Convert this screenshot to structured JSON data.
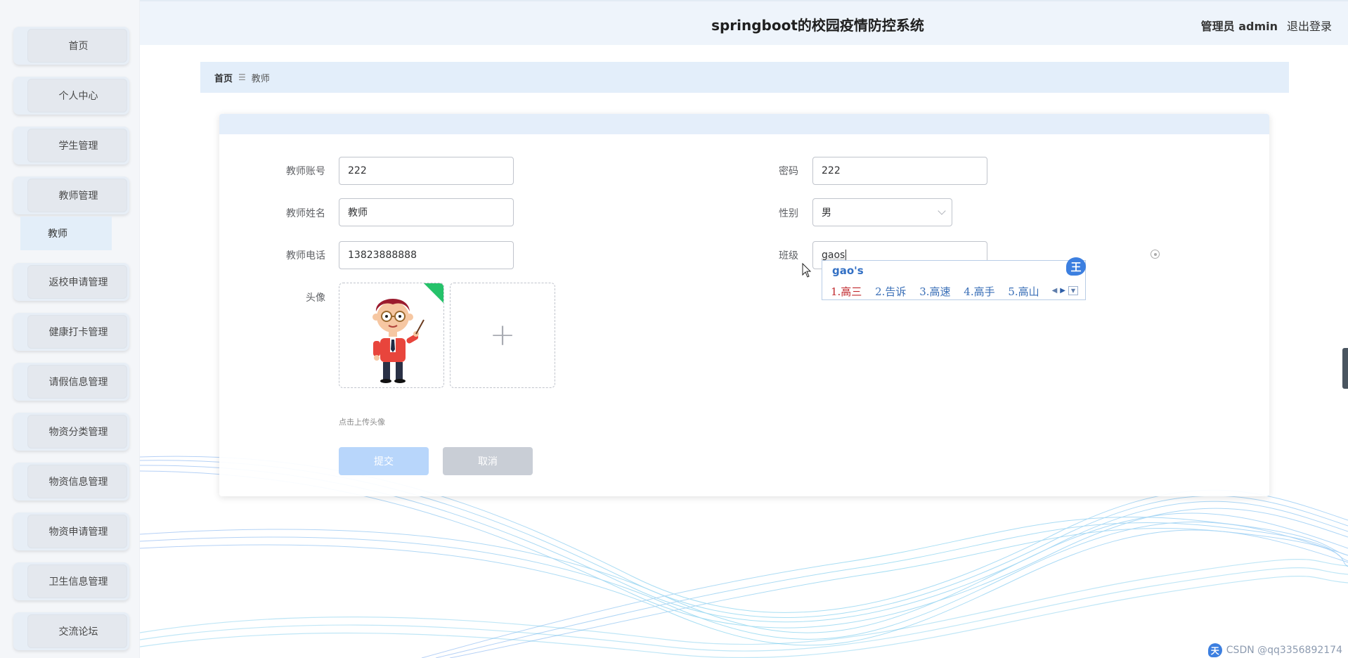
{
  "app": {
    "title": "springboot的校园疫情防控系统",
    "user_label": "管理员 admin",
    "logout_label": "退出登录"
  },
  "sidebar": {
    "items": [
      {
        "label": "首页"
      },
      {
        "label": "个人中心"
      },
      {
        "label": "学生管理"
      },
      {
        "label": "教师管理"
      },
      {
        "label": "返校申请管理"
      },
      {
        "label": "健康打卡管理"
      },
      {
        "label": "请假信息管理"
      },
      {
        "label": "物资分类管理"
      },
      {
        "label": "物资信息管理"
      },
      {
        "label": "物资申请管理"
      },
      {
        "label": "卫生信息管理"
      },
      {
        "label": "交流论坛"
      }
    ],
    "submenu": {
      "label": "教师"
    }
  },
  "breadcrumb": {
    "home": "首页",
    "separator": "☰",
    "current": "教师"
  },
  "form": {
    "account": {
      "label": "教师账号",
      "value": "222"
    },
    "password": {
      "label": "密码",
      "value": "222"
    },
    "name": {
      "label": "教师姓名",
      "value": "教师"
    },
    "gender": {
      "label": "性别",
      "value": "男"
    },
    "phone": {
      "label": "教师电话",
      "value": "13823888888"
    },
    "class": {
      "label": "班级",
      "value": "gaos"
    },
    "avatar": {
      "label": "头像",
      "tip": "点击上传头像",
      "plus": "+"
    },
    "submit_label": "提交",
    "cancel_label": "取消"
  },
  "ime": {
    "composition": "gao's",
    "candidates": [
      "1.高三",
      "2.告诉",
      "3.高速",
      "4.高手",
      "5.高山"
    ],
    "badge": "王"
  },
  "tray": {
    "logo": "天",
    "watermark": "CSDN @qq3356892174"
  },
  "colors": {
    "header_bg": "#eef4fb",
    "breadcrumb_bg": "#e3eefa",
    "submit_bg": "#b8d6fb",
    "cancel_bg": "#c9ced6",
    "ime_accent": "#3c7fe0"
  }
}
